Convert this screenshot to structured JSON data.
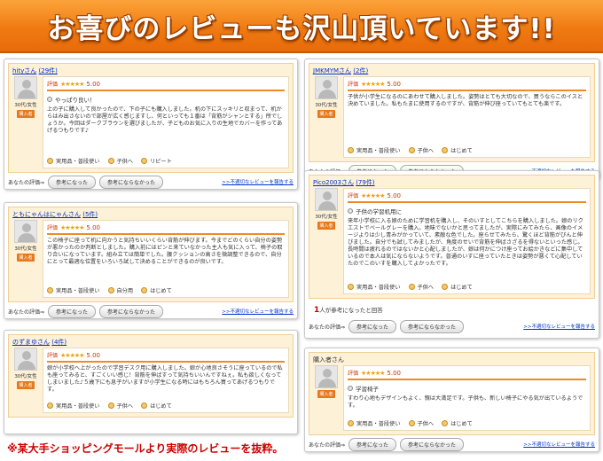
{
  "banner": {
    "title": "お喜びのレビューも沢山頂いています!!"
  },
  "common": {
    "rating_label": "評価",
    "stars": "★★★★★",
    "score": "5.00",
    "age_gender": "30代/女性",
    "buyer": "購入者",
    "your_eval": "あなたの評価⇒",
    "helpful_btn": "参考になった",
    "not_helpful_btn": "参考にならなかった",
    "report_link": ">>不適切なレビューを報告する"
  },
  "reviews": [
    {
      "user": "hityさん",
      "count": "(29件)",
      "subtitle": "やっぱり良い！",
      "text": "上の子に購入して良かったので、下の子にも購入しました。机の下にスッキリと収まって、机からはみ出さないので部屋が広く感じますし、何といっても１番は「背筋がシャンとする」所でしょうか。今回はダークブラウンを選びましたが、子どものお気に入りの生地でカバーを作ってあげるつもりです♪",
      "tags": [
        "実用品・普段使い",
        "子供へ",
        "リピート"
      ]
    },
    {
      "user": "ともにゃんはにゃんさん",
      "count": "(5件)",
      "subtitle": "",
      "text": "この椅子に座って机に向かうと気持ちいいくらい背筋が伸びます。今までどのくらい自分の姿勢が悪かったのか判断としました。購入前にはピンと来ていなかった主人も気に入って、椅子の取り合いになっています。組み立ては簡単でした。腰クッションの高さを微調整できるので、自分にとって最適な位置をいろいろ試して決めることができるのが良いです。",
      "tags": [
        "実用品・普段使い",
        "自分用",
        "はじめて"
      ]
    },
    {
      "user": "のずまゆさん",
      "count": "(4件)",
      "subtitle": "",
      "text": "娘が小学校へ上がったので学習デスク用に購入しました。娘が心地良さそうに座っているので私も座ってみると、すごくいい感じ！背筋を伸ばすって気持ちいいんですねぇ。私も欲しくなってしまいました♪５歳下にも息子がいますが小学生になる時にはもちろん買ってあげるつもりです。",
      "tags": [
        "実用品・普段使い",
        "子供へ",
        "はじめて"
      ]
    },
    {
      "user": "JMKMYMさん",
      "count": "(2件)",
      "subtitle": "",
      "text": "子供が小学生になるのにあわせて購入しました。姿勢はとても大切なので、買うならこのイスと決めていました。私もたまに使用するのですが、背筋が伸び座っていてもとても楽です。",
      "tags": [
        "実用品・普段使い",
        "子供へ",
        "はじめて"
      ]
    },
    {
      "user": "Pico2003さん",
      "count": "(79件)",
      "subtitle": "子供の学習机用に",
      "text": "来年小学校に入る娘のために学習机を購入し、そのいすとしてこちらを購入しました。娘のリクエストでベールグレーを購入。地味でないかと思ってましたが、実際にみてみたら、画像のイメージよりは少し青みがかっていて、素敵な色でした。座らせてみたら、驚くほど背筋がぴんと伸びました。自分でも試してみましたが、角度のせいで背筋を伸ばさざるを得ないといった感じ。長時間は疲れるのではないかと心配しましたが、娘は何かにつけ座ってお絵かきなどに集中しているので本人は気にならないようです。普通のいすに座っていたときは姿勢が悪くて心配していたのでこのいすを購入してよかったです。",
      "tags": [
        "実用品・普段使い",
        "子供へ",
        "はじめて"
      ],
      "helpful_num": "1",
      "helpful_text": "人が参考になったと回答"
    },
    {
      "user": "購入者さん",
      "count": "",
      "subtitle": "学習椅子",
      "text": "すわり心地もデザインもよく、親は大満足です。子供も、新しい椅子にやる気が出ているようです。",
      "tags": [
        "実用品・普段使い",
        "子供へ",
        "はじめて"
      ]
    }
  ],
  "footnote": "※某大手ショッピングモールより実際のレビューを抜粋。"
}
